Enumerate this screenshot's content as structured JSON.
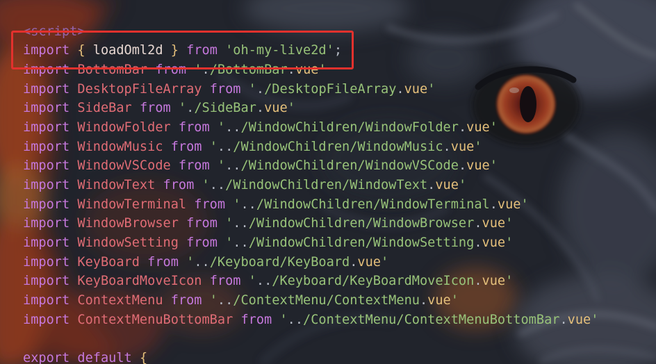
{
  "editor": {
    "highlight_color": "#e3312d",
    "token_colors": {
      "tag": "#9b6ec3",
      "keyword": "#c678dd",
      "brace": "#e5c07b",
      "named": "#e8d8d2",
      "ident": "#e06c75",
      "string": "#98c379",
      "punct": "#b7bcc6",
      "ext": "#e5c07b"
    },
    "lines": [
      {
        "tokens": [
          {
            "tag": "<script>"
          }
        ]
      },
      {
        "tokens": [
          {
            "keyword": "import "
          },
          {
            "brace": "{ "
          },
          {
            "named": "loadOml2d "
          },
          {
            "brace": "} "
          },
          {
            "keyword": "from "
          },
          {
            "string": "'oh-my-live2d'"
          },
          {
            "punct": ";"
          }
        ]
      },
      {
        "tokens": [
          {
            "keyword": "import "
          },
          {
            "ident": "BottomBar "
          },
          {
            "keyword": "from "
          },
          {
            "string": "'"
          },
          {
            "punct": "."
          },
          {
            "string": "/BottomBar"
          },
          {
            "punct": "."
          },
          {
            "ext": "vue"
          },
          {
            "string": "'"
          }
        ]
      },
      {
        "tokens": [
          {
            "keyword": "import "
          },
          {
            "ident": "DesktopFileArray "
          },
          {
            "keyword": "from "
          },
          {
            "string": "'"
          },
          {
            "punct": "."
          },
          {
            "string": "/DesktopFileArray"
          },
          {
            "punct": "."
          },
          {
            "ext": "vue"
          },
          {
            "string": "'"
          }
        ]
      },
      {
        "tokens": [
          {
            "keyword": "import "
          },
          {
            "ident": "SideBar "
          },
          {
            "keyword": "from "
          },
          {
            "string": "'"
          },
          {
            "punct": "."
          },
          {
            "string": "/SideBar"
          },
          {
            "punct": "."
          },
          {
            "ext": "vue"
          },
          {
            "string": "'"
          }
        ]
      },
      {
        "tokens": [
          {
            "keyword": "import "
          },
          {
            "ident": "WindowFolder "
          },
          {
            "keyword": "from "
          },
          {
            "string": "'"
          },
          {
            "punct": ".."
          },
          {
            "string": "/WindowChildren/WindowFolder"
          },
          {
            "punct": "."
          },
          {
            "ext": "vue"
          },
          {
            "string": "'"
          }
        ]
      },
      {
        "tokens": [
          {
            "keyword": "import "
          },
          {
            "ident": "WindowMusic "
          },
          {
            "keyword": "from "
          },
          {
            "string": "'"
          },
          {
            "punct": ".."
          },
          {
            "string": "/WindowChildren/WindowMusic"
          },
          {
            "punct": "."
          },
          {
            "ext": "vue"
          },
          {
            "string": "'"
          }
        ]
      },
      {
        "tokens": [
          {
            "keyword": "import "
          },
          {
            "ident": "WindowVSCode "
          },
          {
            "keyword": "from "
          },
          {
            "string": "'"
          },
          {
            "punct": ".."
          },
          {
            "string": "/WindowChildren/WindowVSCode"
          },
          {
            "punct": "."
          },
          {
            "ext": "vue"
          },
          {
            "string": "'"
          }
        ]
      },
      {
        "tokens": [
          {
            "keyword": "import "
          },
          {
            "ident": "WindowText "
          },
          {
            "keyword": "from "
          },
          {
            "string": "'"
          },
          {
            "punct": ".."
          },
          {
            "string": "/WindowChildren/WindowText"
          },
          {
            "punct": "."
          },
          {
            "ext": "vue"
          },
          {
            "string": "'"
          }
        ]
      },
      {
        "tokens": [
          {
            "keyword": "import "
          },
          {
            "ident": "WindowTerminal "
          },
          {
            "keyword": "from "
          },
          {
            "string": "'"
          },
          {
            "punct": ".."
          },
          {
            "string": "/WindowChildren/WindowTerminal"
          },
          {
            "punct": "."
          },
          {
            "ext": "vue"
          },
          {
            "string": "'"
          }
        ]
      },
      {
        "tokens": [
          {
            "keyword": "import "
          },
          {
            "ident": "WindowBrowser "
          },
          {
            "keyword": "from "
          },
          {
            "string": "'"
          },
          {
            "punct": ".."
          },
          {
            "string": "/WindowChildren/WindowBrowser"
          },
          {
            "punct": "."
          },
          {
            "ext": "vue"
          },
          {
            "string": "'"
          }
        ]
      },
      {
        "tokens": [
          {
            "keyword": "import "
          },
          {
            "ident": "WindowSetting "
          },
          {
            "keyword": "from "
          },
          {
            "string": "'"
          },
          {
            "punct": ".."
          },
          {
            "string": "/WindowChildren/WindowSetting"
          },
          {
            "punct": "."
          },
          {
            "ext": "vue"
          },
          {
            "string": "'"
          }
        ]
      },
      {
        "tokens": [
          {
            "keyword": "import "
          },
          {
            "ident": "KeyBoard "
          },
          {
            "keyword": "from "
          },
          {
            "string": "'"
          },
          {
            "punct": ".."
          },
          {
            "string": "/Keyboard/KeyBoard"
          },
          {
            "punct": "."
          },
          {
            "ext": "vue"
          },
          {
            "string": "'"
          }
        ]
      },
      {
        "tokens": [
          {
            "keyword": "import "
          },
          {
            "ident": "KeyBoardMoveIcon "
          },
          {
            "keyword": "from "
          },
          {
            "string": "'"
          },
          {
            "punct": ".."
          },
          {
            "string": "/Keyboard/KeyBoardMoveIcon"
          },
          {
            "punct": "."
          },
          {
            "ext": "vue"
          },
          {
            "string": "'"
          }
        ]
      },
      {
        "tokens": [
          {
            "keyword": "import "
          },
          {
            "ident": "ContextMenu "
          },
          {
            "keyword": "from "
          },
          {
            "string": "'"
          },
          {
            "punct": ".."
          },
          {
            "string": "/ContextMenu/ContextMenu"
          },
          {
            "punct": "."
          },
          {
            "ext": "vue"
          },
          {
            "string": "'"
          }
        ]
      },
      {
        "tokens": [
          {
            "keyword": "import "
          },
          {
            "ident": "ContextMenuBottomBar "
          },
          {
            "keyword": "from "
          },
          {
            "string": "'"
          },
          {
            "punct": ".."
          },
          {
            "string": "/ContextMenu/ContextMenuBottomBar"
          },
          {
            "punct": "."
          },
          {
            "ext": "vue"
          },
          {
            "string": "'"
          }
        ]
      },
      {
        "tokens": []
      },
      {
        "tokens": [
          {
            "keyword": "export "
          },
          {
            "keyword": "default "
          },
          {
            "brace": "{"
          }
        ]
      }
    ]
  }
}
